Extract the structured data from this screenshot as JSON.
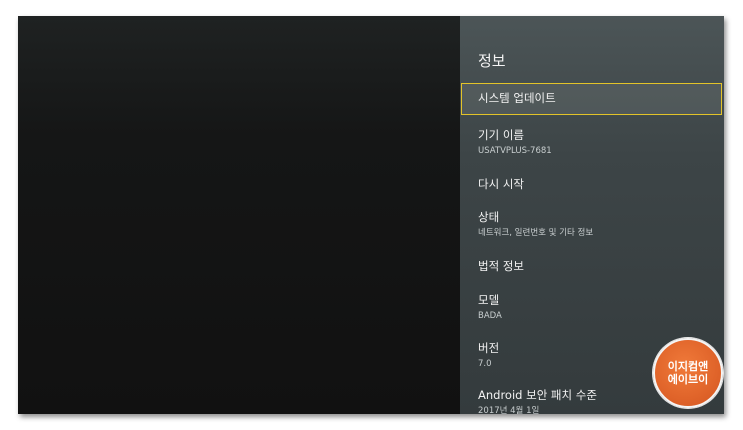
{
  "panel": {
    "title": "정보"
  },
  "items": [
    {
      "title": "시스템 업데이트",
      "subtitle": ""
    },
    {
      "title": "기기 이름",
      "subtitle": "USATVPLUS-7681"
    },
    {
      "title": "다시 시작",
      "subtitle": ""
    },
    {
      "title": "상태",
      "subtitle": "네트워크, 일련번호 및 기타 정보"
    },
    {
      "title": "법적 정보",
      "subtitle": ""
    },
    {
      "title": "모델",
      "subtitle": "BADA"
    },
    {
      "title": "버전",
      "subtitle": "7.0"
    },
    {
      "title": "Android 보안 패치 수준",
      "subtitle": "2017년 4월 1일"
    }
  ],
  "watermark": {
    "line1": "이지컴앤",
    "line2": "에이브이"
  },
  "colors": {
    "selection_border": "#e3c329",
    "panel_bg": "#3d4547",
    "watermark_bg": "#e0642a"
  }
}
